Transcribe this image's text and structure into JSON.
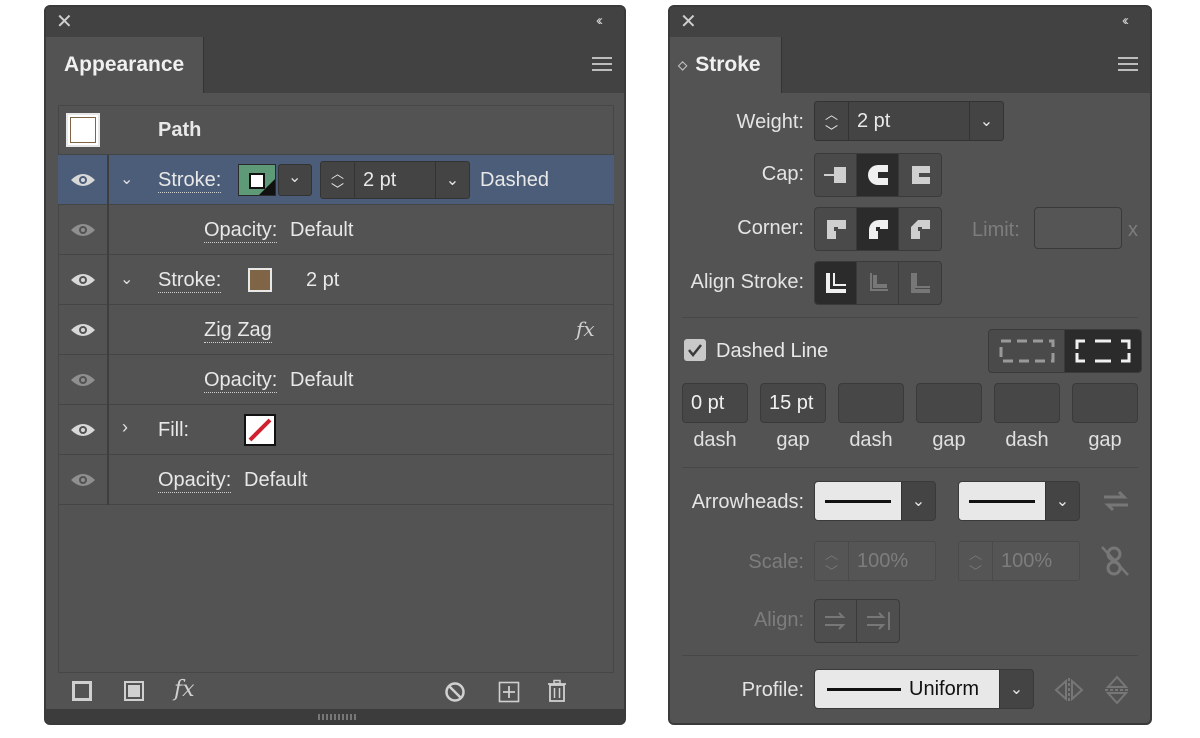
{
  "appearance": {
    "tab_title": "Appearance",
    "path_label": "Path",
    "rows": [
      {
        "label": "Stroke:",
        "weight": "2 pt",
        "style": "Dashed"
      },
      {
        "label": "Opacity:",
        "value": "Default"
      },
      {
        "label": "Stroke:",
        "weight": "2 pt"
      },
      {
        "label": "Zig Zag",
        "fx": "fx"
      },
      {
        "label": "Opacity:",
        "value": "Default"
      },
      {
        "label": "Fill:"
      },
      {
        "label": "Opacity:",
        "value": "Default"
      }
    ],
    "footer_fx": "fx"
  },
  "stroke": {
    "tab_title": "Stroke",
    "weight_label": "Weight:",
    "weight_value": "2 pt",
    "cap_label": "Cap:",
    "corner_label": "Corner:",
    "limit_label": "Limit:",
    "limit_unit": "x",
    "align_stroke_label": "Align Stroke:",
    "dashed_line_label": "Dashed Line",
    "dash_fields": [
      {
        "value": "0 pt",
        "caption": "dash"
      },
      {
        "value": "15 pt",
        "caption": "gap"
      },
      {
        "value": "",
        "caption": "dash"
      },
      {
        "value": "",
        "caption": "gap"
      },
      {
        "value": "",
        "caption": "dash"
      },
      {
        "value": "",
        "caption": "gap"
      }
    ],
    "arrowheads_label": "Arrowheads:",
    "scale_label": "Scale:",
    "scale_start": "100%",
    "scale_end": "100%",
    "align_label": "Align:",
    "profile_label": "Profile:",
    "profile_value": "Uniform"
  },
  "colors": {
    "panel_bg": "#535353",
    "selected_row": "#4b5d78",
    "stroke_swatch_green": "#5f9a78",
    "stroke_swatch_brown": "#7f6545",
    "fill_none_red": "#d0202e"
  }
}
